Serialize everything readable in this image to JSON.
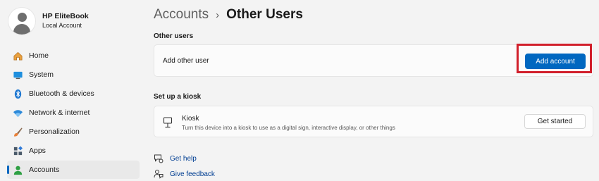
{
  "profile": {
    "name": "HP EliteBook",
    "account_type": "Local Account"
  },
  "nav": {
    "items": [
      {
        "label": "Home",
        "icon": "home-icon"
      },
      {
        "label": "System",
        "icon": "monitor-icon"
      },
      {
        "label": "Bluetooth & devices",
        "icon": "bluetooth-icon"
      },
      {
        "label": "Network & internet",
        "icon": "wifi-icon"
      },
      {
        "label": "Personalization",
        "icon": "brush-icon"
      },
      {
        "label": "Apps",
        "icon": "apps-icon"
      },
      {
        "label": "Accounts",
        "icon": "person-icon",
        "active": true
      }
    ]
  },
  "breadcrumb": {
    "parent": "Accounts",
    "separator": "›",
    "current": "Other Users"
  },
  "other_users": {
    "section_label": "Other users",
    "row_label": "Add other user",
    "button_label": "Add account"
  },
  "kiosk": {
    "section_label": "Set up a kiosk",
    "title": "Kiosk",
    "description": "Turn this device into a kiosk to use as a digital sign, interactive display, or other things",
    "button_label": "Get started"
  },
  "links": {
    "help": "Get help",
    "feedback": "Give feedback"
  },
  "colors": {
    "accent": "#0067c0",
    "highlight": "#d11f2b",
    "link": "#003e92"
  }
}
